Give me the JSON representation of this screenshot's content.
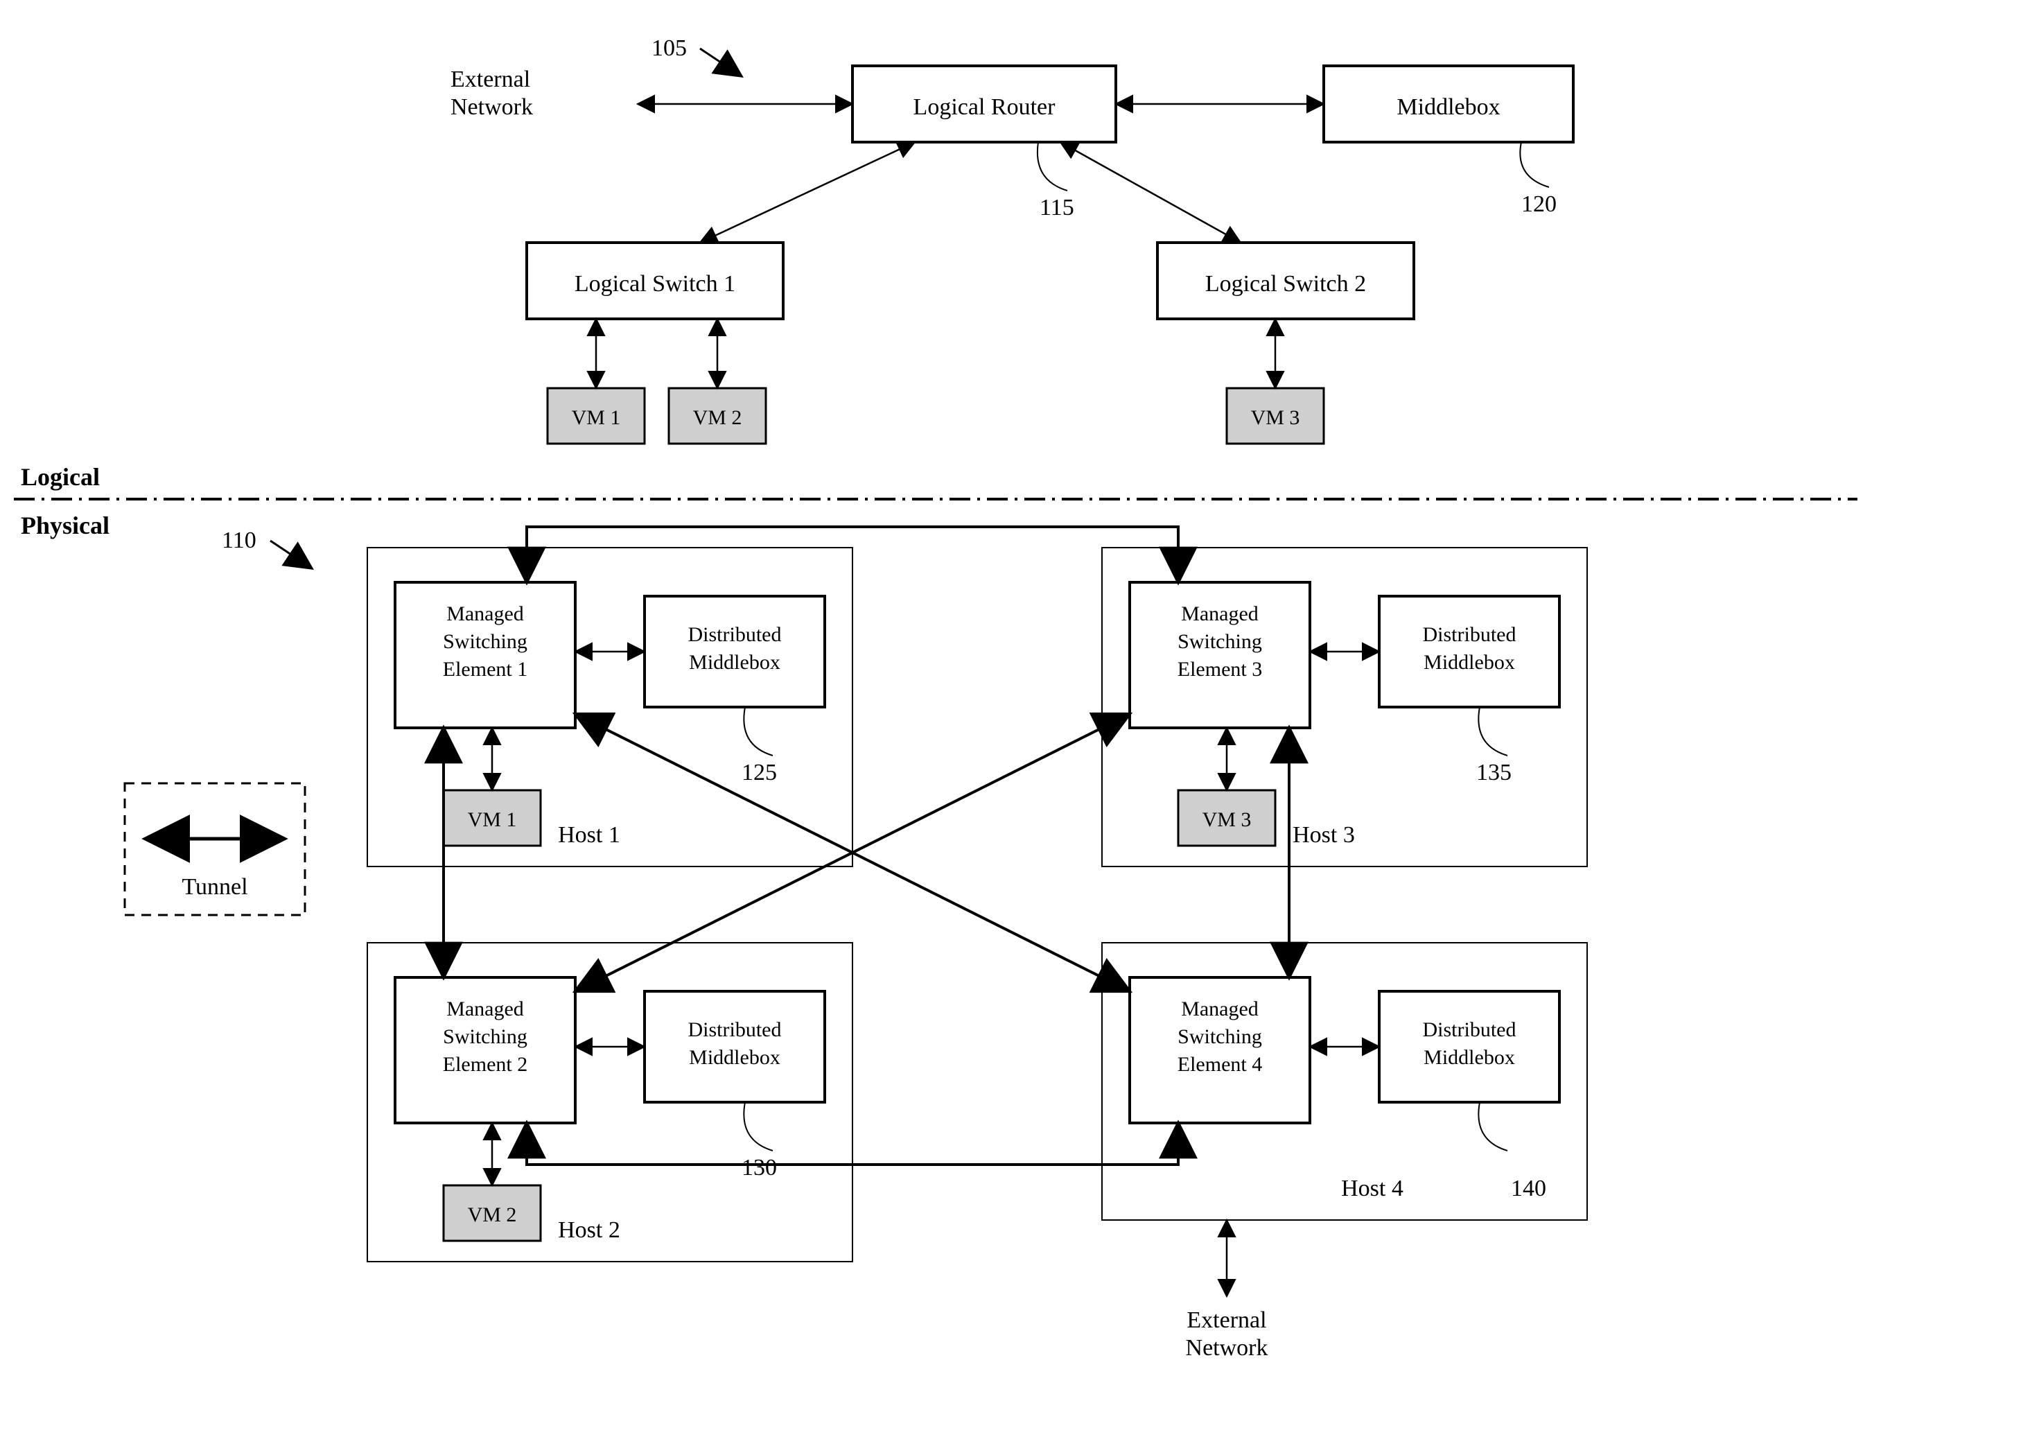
{
  "sections": {
    "logical": "Logical",
    "physical": "Physical"
  },
  "refs": {
    "r105": "105",
    "r110": "110",
    "r115": "115",
    "r120": "120",
    "r125": "125",
    "r130": "130",
    "r135": "135",
    "r140": "140"
  },
  "external": {
    "top": "External Network",
    "bottom": "External Network"
  },
  "legend": {
    "tunnel": "Tunnel"
  },
  "logical": {
    "router": "Logical Router",
    "middlebox": "Middlebox",
    "switches": {
      "s1": "Logical Switch 1",
      "s2": "Logical Switch 2"
    },
    "vms": {
      "v1": "VM 1",
      "v2": "VM 2",
      "v3": "VM 3"
    }
  },
  "physical": {
    "hosts": {
      "h1": "Host 1",
      "h2": "Host 2",
      "h3": "Host 3",
      "h4": "Host 4"
    },
    "mse": {
      "m1": "Managed Switching Element 1",
      "m2": "Managed Switching Element 2",
      "m3": "Managed Switching Element 3",
      "m4": "Managed Switching Element 4"
    },
    "dmb": "Distributed Middlebox",
    "vms": {
      "v1": "VM 1",
      "v2": "VM 2",
      "v3": "VM 3"
    }
  }
}
